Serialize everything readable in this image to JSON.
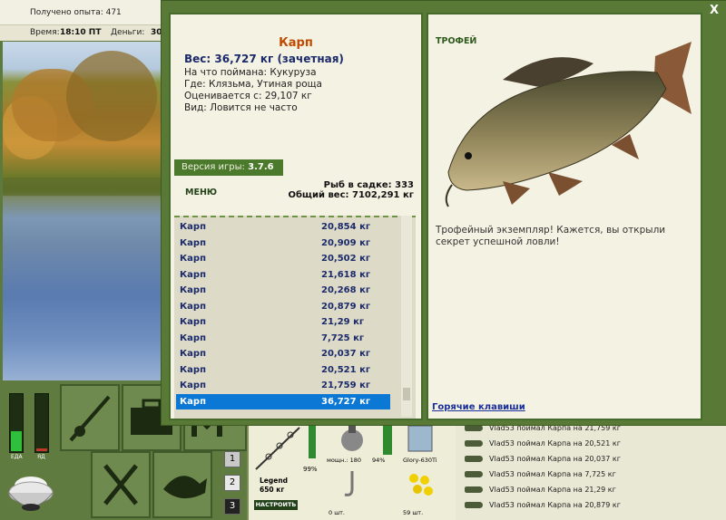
{
  "hud": {
    "exp_label": "Получено опыта: 471",
    "time_label": "Время:",
    "time_value": "18:10 ПТ",
    "money_label": "Деньги:",
    "money_value": "30"
  },
  "meters": {
    "food_label": "ЕДА",
    "poison_label": "ЯД",
    "food_level": 0.35,
    "poison_level": 0.05
  },
  "slots": [
    "1",
    "2",
    "3"
  ],
  "rod": {
    "name": "Legend",
    "weight": "650 кг",
    "percent": "99%",
    "reel_label": "мощн.: 180",
    "reel_percent": "94%",
    "line_name": "Glory-630Ti",
    "hook_count": "0 шт.",
    "bait_count": "59 шт.",
    "setup_button": "НАСТРОИТЬ"
  },
  "chat": [
    "Vlad53 поймал Карпа на 21,759 кг",
    "Vlad53 поймал Карпа на 20,521 кг",
    "Vlad53 поймал Карпа на 20,037 кг",
    "Vlad53 поймал Карпа на 7,725 кг",
    "Vlad53 поймал Карпа на 21,29 кг",
    "Vlad53 поймал Карпа на 20,879 кг"
  ],
  "dialog": {
    "close": "X",
    "fish_name": "Карп",
    "weight": "Вес: 36,727 кг (зачетная)",
    "bait": "На что поймана: Кукуруза",
    "place": "Где: Клязьма, Утиная роща",
    "valued": "Оценивается с: 29,107 кг",
    "kind": "Вид: Ловится не часто",
    "version_label": "Версия игры:",
    "version_value": "3.7.6",
    "menu": "МЕНЮ",
    "fish_in_keepnet": "Рыб в садке: 333",
    "total_weight": "Общий вес: 7102,291 кг",
    "catches": [
      {
        "name": "Карп",
        "weight": "20,854 кг"
      },
      {
        "name": "Карп",
        "weight": "20,909 кг"
      },
      {
        "name": "Карп",
        "weight": "20,502 кг"
      },
      {
        "name": "Карп",
        "weight": "21,618 кг"
      },
      {
        "name": "Карп",
        "weight": "20,268 кг"
      },
      {
        "name": "Карп",
        "weight": "20,879 кг"
      },
      {
        "name": "Карп",
        "weight": "21,29 кг"
      },
      {
        "name": "Карп",
        "weight": "7,725 кг"
      },
      {
        "name": "Карп",
        "weight": "20,037 кг"
      },
      {
        "name": "Карп",
        "weight": "20,521 кг"
      },
      {
        "name": "Карп",
        "weight": "21,759 кг"
      },
      {
        "name": "Карп",
        "weight": "36,727 кг"
      }
    ],
    "selected_index": 11,
    "trophy_label": "ТРОФЕЙ",
    "trophy_text": "Трофейный экземпляр! Кажется, вы открыли секрет успешной ловли!",
    "hotkeys": "Горячие клавиши"
  }
}
